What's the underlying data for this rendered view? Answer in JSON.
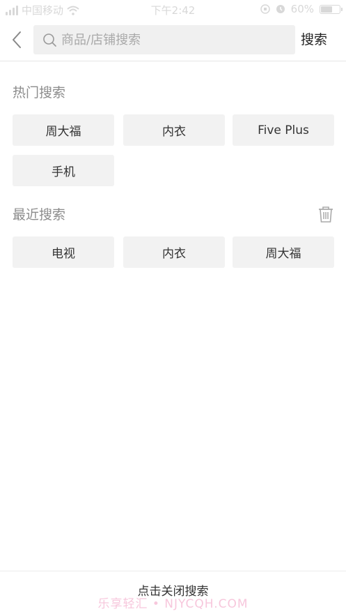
{
  "status_bar": {
    "carrier": "中国移动",
    "time": "下午2:42",
    "battery_percent": "60%",
    "battery_level": 0.6,
    "signal_icon": "signal-icon",
    "wifi_icon": "wifi-icon"
  },
  "header": {
    "back_icon": "chevron-left-icon",
    "search_placeholder": "商品/店铺搜索",
    "search_value": "",
    "search_button": "搜索"
  },
  "hot_search": {
    "title": "热门搜索",
    "items": [
      "周大福",
      "内衣",
      "Five Plus",
      "手机"
    ]
  },
  "recent_search": {
    "title": "最近搜索",
    "clear_icon": "trash-icon",
    "items": [
      "电视",
      "内衣",
      "周大福"
    ]
  },
  "footer": {
    "close_label": "点击关闭搜索",
    "watermark": "乐享轻汇 • NJYCQH.COM"
  },
  "colors": {
    "chip_bg": "#f2f2f2",
    "section_title": "#8c8c8c",
    "watermark": "#f7c7dc"
  }
}
